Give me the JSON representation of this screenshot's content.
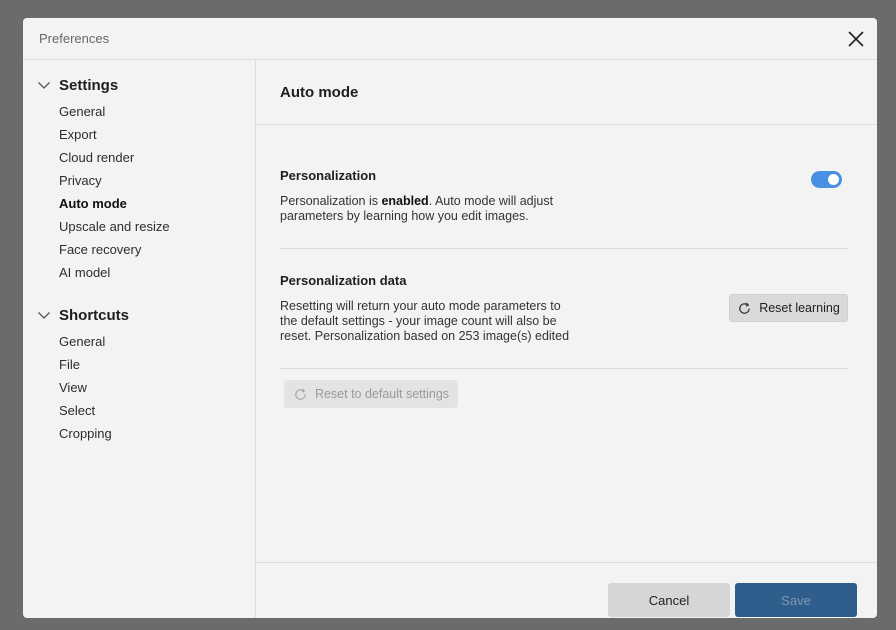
{
  "window": {
    "title": "Preferences"
  },
  "sidebar": {
    "groups": [
      {
        "label": "Settings",
        "items": [
          "General",
          "Export",
          "Cloud render",
          "Privacy",
          "Auto mode",
          "Upscale and resize",
          "Face recovery",
          "AI model"
        ]
      },
      {
        "label": "Shortcuts",
        "items": [
          "General",
          "File",
          "View",
          "Select",
          "Cropping"
        ]
      }
    ],
    "active_item": "Auto mode"
  },
  "main": {
    "title": "Auto mode",
    "personalization": {
      "heading": "Personalization",
      "text_before": "Personalization is ",
      "text_bold": "enabled",
      "text_after": ". Auto mode will adjust parameters by learning how you edit images.",
      "toggle_on": true
    },
    "personalization_data": {
      "heading": "Personalization data",
      "text": "Resetting will return your auto mode parameters to the default settings - your image count will also be reset. Personalization based on 253 image(s) edited",
      "reset_learning_label": "Reset learning"
    },
    "reset_default_label": "Reset to default settings"
  },
  "footer": {
    "cancel_label": "Cancel",
    "save_label": "Save"
  },
  "colors": {
    "accent": "#4a90e2",
    "primary_button": "#2f5d8c",
    "overlay": "#6b6b6b"
  },
  "icons": [
    "close-icon",
    "chevron-down-icon",
    "refresh-icon"
  ]
}
